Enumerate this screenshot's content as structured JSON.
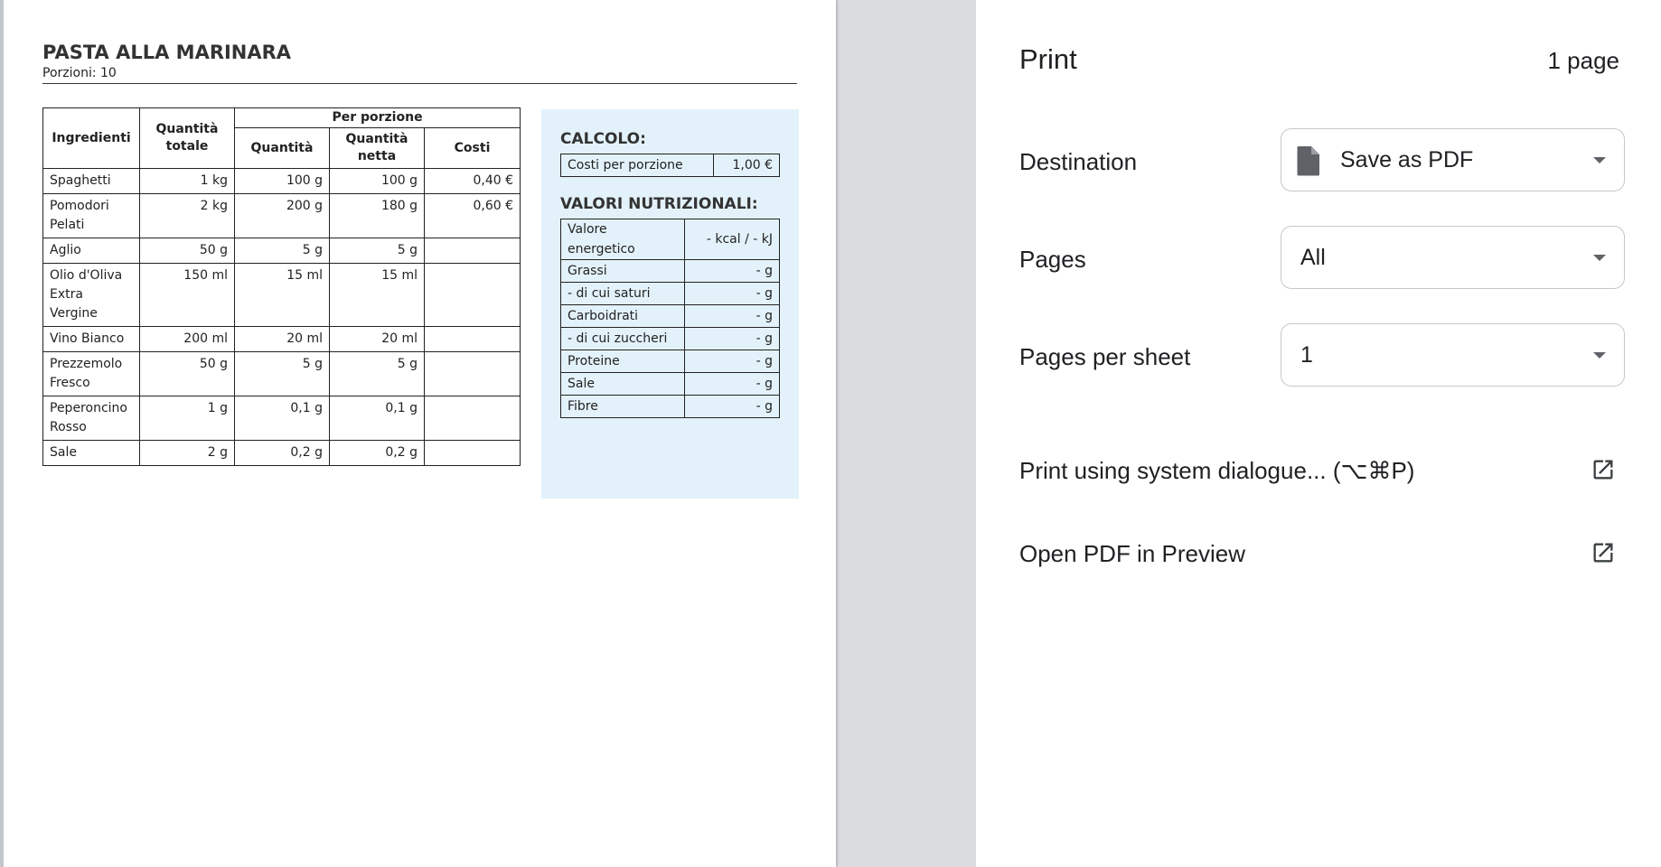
{
  "document": {
    "title": "PASTA ALLA MARINARA",
    "subtitle": "Porzioni: 10",
    "table": {
      "headers": {
        "ingredienti": "Ingredienti",
        "quantita_totale": "Quantità totale",
        "per_porzione": "Per porzione",
        "quantita": "Quantità",
        "quantita_netta": "Quantità netta",
        "costi": "Costi"
      },
      "rows": [
        {
          "name": "Spaghetti",
          "totale": "1 kg",
          "quantita": "100 g",
          "netta": "100 g",
          "costi": "0,40 €"
        },
        {
          "name": "Pomodori Pelati",
          "totale": "2 kg",
          "quantita": "200 g",
          "netta": "180 g",
          "costi": "0,60 €"
        },
        {
          "name": "Aglio",
          "totale": "50 g",
          "quantita": "5 g",
          "netta": "5 g",
          "costi": ""
        },
        {
          "name": "Olio d'Oliva Extra Vergine",
          "totale": "150 ml",
          "quantita": "15 ml",
          "netta": "15 ml",
          "costi": ""
        },
        {
          "name": "Vino Bianco",
          "totale": "200 ml",
          "quantita": "20 ml",
          "netta": "20 ml",
          "costi": ""
        },
        {
          "name": "Prezzemolo Fresco",
          "totale": "50 g",
          "quantita": "5 g",
          "netta": "5 g",
          "costi": ""
        },
        {
          "name": "Peperoncino Rosso",
          "totale": "1 g",
          "quantita": "0,1 g",
          "netta": "0,1 g",
          "costi": ""
        },
        {
          "name": "Sale",
          "totale": "2 g",
          "quantita": "0,2 g",
          "netta": "0,2 g",
          "costi": ""
        }
      ]
    },
    "calcolo": {
      "heading": "CALCOLO:",
      "label": "Costi per porzione",
      "value": "1,00 €"
    },
    "nutrizione": {
      "heading": "VALORI NUTRIZIONALI:",
      "rows": [
        {
          "label": "Valore energetico",
          "value": "- kcal / - kJ"
        },
        {
          "label": "Grassi",
          "value": "- g"
        },
        {
          "label": "- di cui saturi",
          "value": "- g"
        },
        {
          "label": "Carboidrati",
          "value": "- g"
        },
        {
          "label": "- di cui zuccheri",
          "value": "- g"
        },
        {
          "label": "Proteine",
          "value": "- g"
        },
        {
          "label": "Sale",
          "value": "- g"
        },
        {
          "label": "Fibre",
          "value": "- g"
        }
      ]
    }
  },
  "panel": {
    "title": "Print",
    "page_count": "1 page",
    "destination": {
      "label": "Destination",
      "value": "Save as PDF",
      "icon": "file-icon"
    },
    "pages": {
      "label": "Pages",
      "value": "All"
    },
    "pages_per_sheet": {
      "label": "Pages per sheet",
      "value": "1"
    },
    "system_dialog": {
      "label": "Print using system dialogue... (⌥⌘P)",
      "icon": "open-external-icon"
    },
    "open_preview": {
      "label": "Open PDF in Preview",
      "icon": "open-external-icon"
    }
  }
}
